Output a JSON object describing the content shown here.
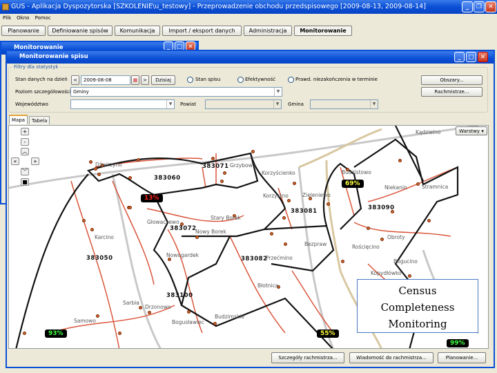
{
  "app": {
    "title": "GUS - Aplikacja Dyspozytorska [SZKOLENIE\\u_testowy] - Przeprowadzenie obchodu przedspisowego [2009-08-13, 2009-08-14]"
  },
  "menu": [
    "Plik",
    "Okno",
    "Pomoc"
  ],
  "modules": [
    "Planowanie",
    "Definiowanie spisów",
    "Komunikacja",
    "Import / eksport danych",
    "Administracja",
    "Monitorowanie"
  ],
  "back_window": {
    "title": "Monitorowanie"
  },
  "window": {
    "title": "Monitorowanie spisu"
  },
  "filters": {
    "group_title": "Filtry dla statystyk",
    "date_label": "Stan danych na dzień",
    "prev": "<",
    "date_value": "2009-08-08",
    "next": ">",
    "today": "Dzisiaj",
    "radios": [
      "Stan spisu",
      "Efektywność",
      "Prawd. niezakończenia w terminie"
    ],
    "level_label": "Poziom szczegółowości",
    "level_value": "Gminy",
    "voivodeship_label": "Województwo",
    "county_label": "Powiat",
    "commune_label": "Gmina",
    "areas_button": "Obszary...",
    "enumerators_button": "Rachmistrze..."
  },
  "tabs": [
    "Mapa",
    "Tabela"
  ],
  "map": {
    "layers_button": "Warstwy",
    "controls": {
      "zoom_in": "+",
      "zoom_out": "-"
    },
    "places": [
      "Dźwirzyno",
      "Grzybowo",
      "Korzyścienko",
      "Korzystno",
      "Zieleniewo",
      "Budzistowo",
      "Niekanin",
      "Stramnica",
      "Kądzielno",
      "Głowaczewo",
      "Stary Borek",
      "Nowy Borek",
      "Karcino",
      "Nowogardek",
      "Przećmino",
      "Bezpraw",
      "Rościęcino",
      "Obroty",
      "Bogucino",
      "Kopydłówko",
      "Błotnica",
      "Sarbia",
      "Drzonowo",
      "Samowo",
      "Bogusławiec",
      "Budzimskie"
    ],
    "codes": [
      "383071",
      "383060",
      "383081",
      "383090",
      "383072",
      "383050",
      "383082",
      "383100"
    ],
    "percentages": [
      {
        "value": "13%",
        "color": "#ff2020"
      },
      {
        "value": "69%",
        "color": "#ffff40"
      },
      {
        "value": "93%",
        "color": "#40ff40"
      },
      {
        "value": "55%",
        "color": "#ffff40"
      },
      {
        "value": "99%",
        "color": "#40ff40"
      }
    ]
  },
  "overlay": {
    "lines": [
      "Census",
      "Completeness",
      "Monitoring"
    ]
  },
  "bottom_buttons": [
    "Szczegóły rachmistrza...",
    "Wiadomość do rachmistrza...",
    "Planowanie..."
  ]
}
